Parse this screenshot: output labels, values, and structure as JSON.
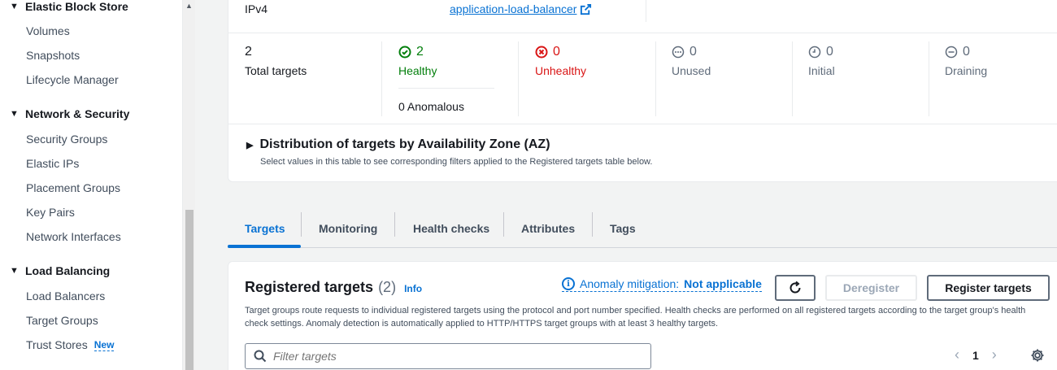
{
  "sidebar": {
    "sections": [
      {
        "label": "Elastic Block Store",
        "items": [
          "Volumes",
          "Snapshots",
          "Lifecycle Manager"
        ]
      },
      {
        "label": "Network & Security",
        "items": [
          "Security Groups",
          "Elastic IPs",
          "Placement Groups",
          "Key Pairs",
          "Network Interfaces"
        ]
      },
      {
        "label": "Load Balancing",
        "items": [
          "Load Balancers",
          "Target Groups",
          "Trust Stores"
        ]
      }
    ],
    "new_badge": "New"
  },
  "details": {
    "ip_type": "IPv4",
    "load_balancer_link": "application-load-balancer"
  },
  "stats": {
    "total": {
      "value": "2",
      "label": "Total targets"
    },
    "healthy": {
      "value": "2",
      "label": "Healthy"
    },
    "unhealthy": {
      "value": "0",
      "label": "Unhealthy"
    },
    "unused": {
      "value": "0",
      "label": "Unused"
    },
    "initial": {
      "value": "0",
      "label": "Initial"
    },
    "draining": {
      "value": "0",
      "label": "Draining"
    },
    "anomalous": "0 Anomalous"
  },
  "distribution": {
    "title": "Distribution of targets by Availability Zone (AZ)",
    "subtitle": "Select values in this table to see corresponding filters applied to the Registered targets table below."
  },
  "tabs": [
    "Targets",
    "Monitoring",
    "Health checks",
    "Attributes",
    "Tags"
  ],
  "registered": {
    "title": "Registered targets",
    "count": "(2)",
    "info": "Info",
    "anomaly_prefix": "Anomaly mitigation:",
    "anomaly_value": "Not applicable",
    "deregister": "Deregister",
    "register": "Register targets",
    "description": "Target groups route requests to individual registered targets using the protocol and port number specified. Health checks are performed on all registered targets according to the target group's health check settings. Anomaly detection is automatically applied to HTTP/HTTPS target groups with at least 3 healthy targets.",
    "filter_placeholder": "Filter targets",
    "page": "1"
  },
  "colors": {
    "link": "#0972d3",
    "healthy": "#037f0c",
    "unhealthy": "#d91515"
  }
}
